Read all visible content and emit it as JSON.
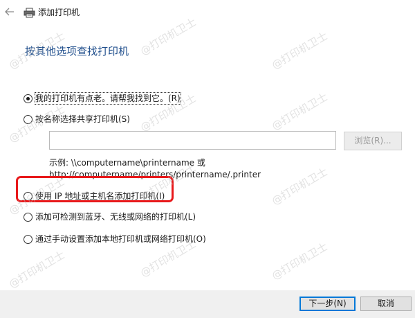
{
  "window": {
    "title": "添加打印机",
    "back_icon": "arrow-left-icon",
    "printer_icon": "printer-icon"
  },
  "heading": "按其他选项查找打印机",
  "options": [
    {
      "label": "我的打印机有点老。请帮我找到它。(R)",
      "checked": true
    },
    {
      "label": "按名称选择共享打印机(S)",
      "checked": false
    },
    {
      "label": "使用 IP 地址或主机名添加打印机(I)",
      "checked": false
    },
    {
      "label": "添加可检测到蓝牙、无线或网络的打印机(L)",
      "checked": false
    },
    {
      "label": "通过手动设置添加本地打印机或网络打印机(O)",
      "checked": false
    }
  ],
  "share": {
    "input_value": "",
    "browse_label": "浏览(R)...",
    "example_line1": "示例: \\\\computername\\printername 或",
    "example_line2": "http://computername/printers/printername/.printer"
  },
  "footer": {
    "next_label": "下一步(N)",
    "cancel_label": "取消"
  },
  "watermark": "@打印机卫士",
  "colors": {
    "heading": "#1f4e8c",
    "highlight": "#e8191b",
    "primary_border": "#0078d7"
  }
}
